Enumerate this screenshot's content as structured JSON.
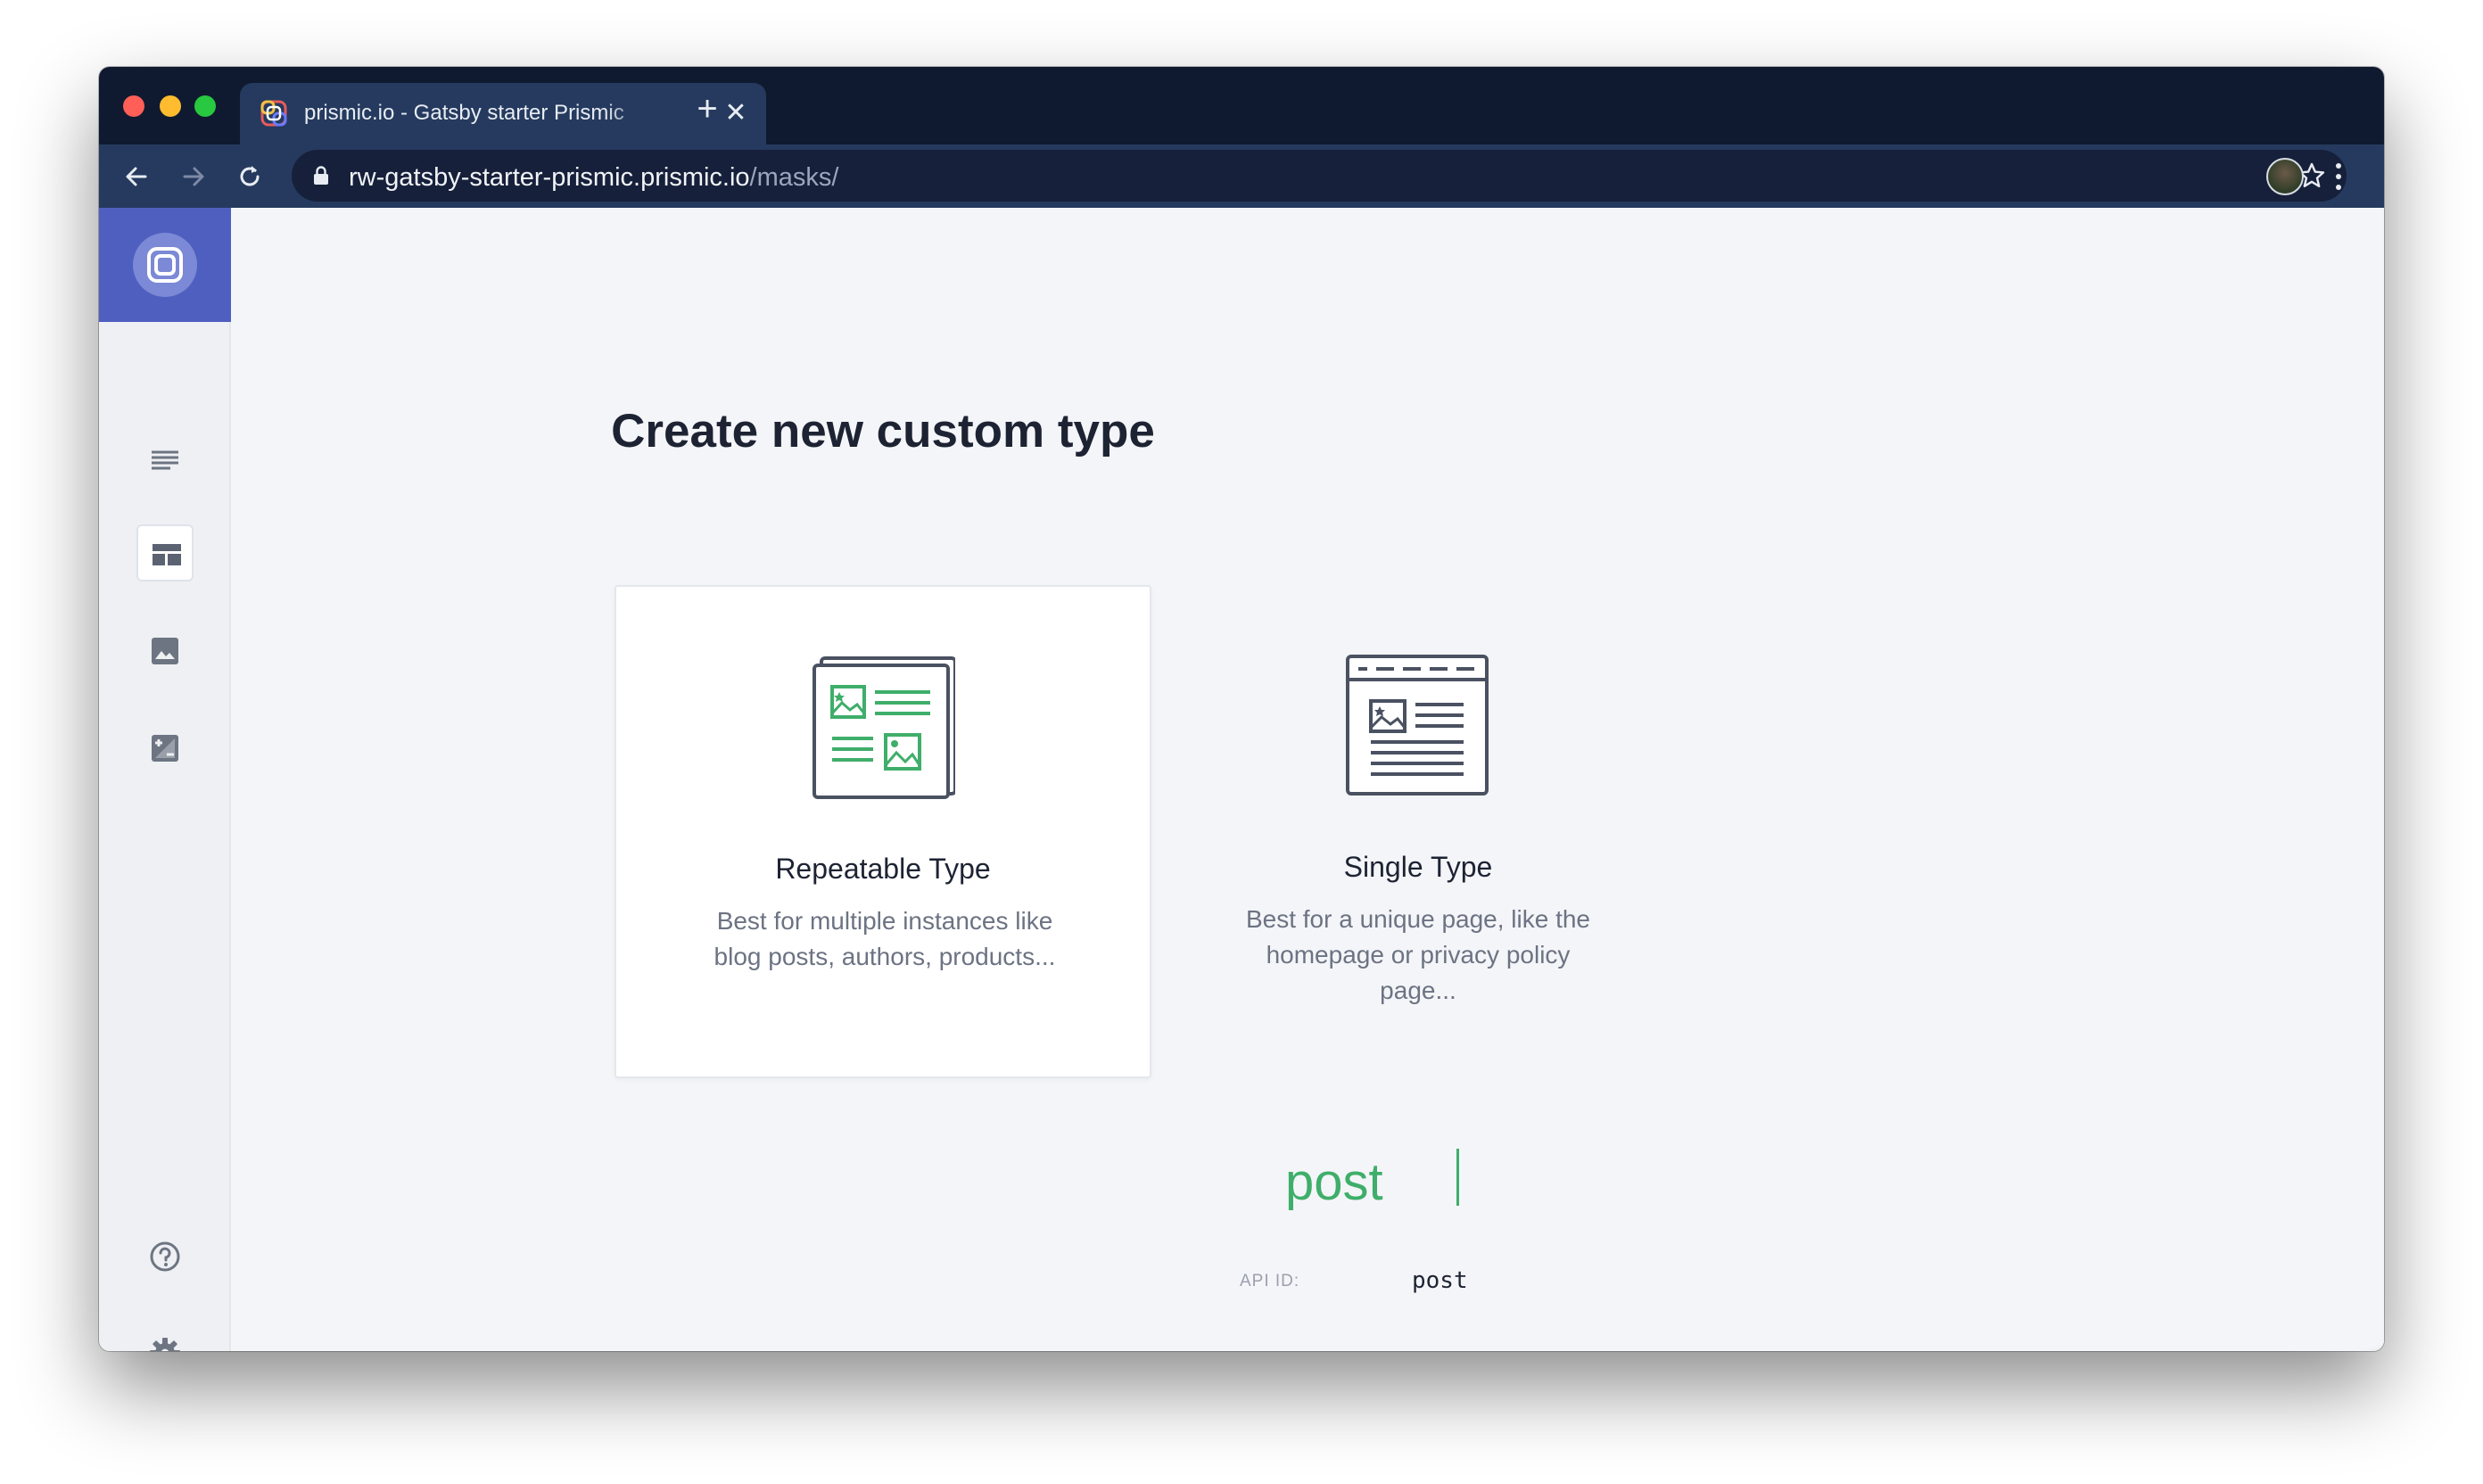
{
  "browser": {
    "tab_title": "prismic.io - Gatsby starter Prismic",
    "url_host": "rw-gatsby-starter-prismic.prismic.io",
    "url_path": "/masks/",
    "tab_close_glyph": "✕",
    "new_tab_glyph": "+"
  },
  "sidebar": {
    "items": [
      {
        "icon": "documents-icon"
      },
      {
        "icon": "custom-types-icon",
        "active": true
      },
      {
        "icon": "media-library-icon"
      },
      {
        "icon": "image-edit-icon"
      },
      {
        "icon": "help-icon"
      },
      {
        "icon": "settings-icon"
      }
    ]
  },
  "main": {
    "heading": "Create new custom type",
    "repeatable": {
      "title": "Repeatable Type",
      "description": "Best for multiple instances like blog posts, authors, products..."
    },
    "single": {
      "title": "Single Type",
      "description": "Best for a unique page, like the homepage or privacy policy page..."
    },
    "type_name": "post",
    "api_id_label": "API ID:",
    "api_id_value": "post"
  },
  "colors": {
    "brand": "#4f5fbf",
    "accent_green": "#3fae6a",
    "browser_frame": "#0f1a30",
    "toolbar": "#253a5e"
  }
}
